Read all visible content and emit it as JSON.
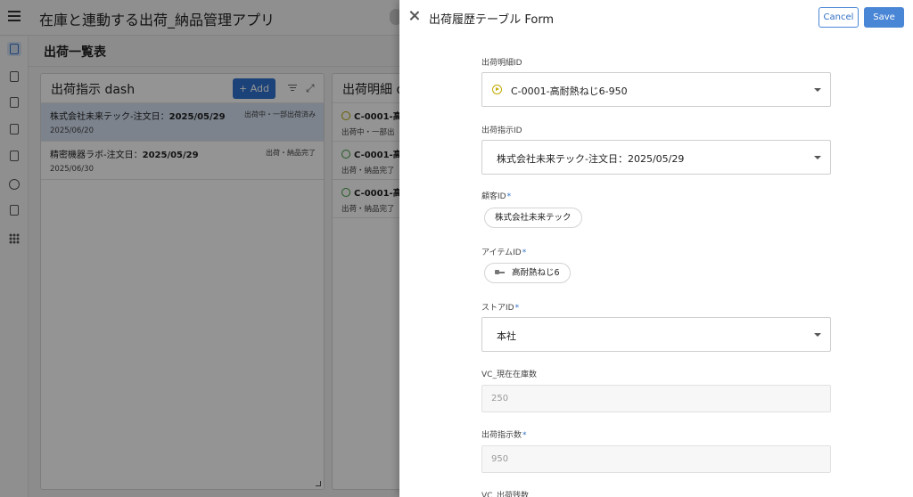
{
  "app": {
    "title": "在庫と連動する出荷_納品管理アプリ",
    "section_title": "出荷一覧表"
  },
  "left_panel": {
    "title": "出荷指示 dash",
    "add_label": "+ Add",
    "rows": [
      {
        "title_prefix": "株式会社未来テック-注文日：",
        "title_date": "2025/05/29",
        "status": "出荷中・一部出荷済み",
        "sub": "2025/06/20"
      },
      {
        "title_prefix": "精密機器ラボ-注文日：",
        "title_date": "2025/05/29",
        "status": "出荷・納品完了",
        "sub": "2025/06/30"
      }
    ]
  },
  "right_panel": {
    "title": "出荷明細 da",
    "rows": [
      {
        "title": "C-0001-高",
        "sub": "出荷中・一部出",
        "icon": "play-circle-icon"
      },
      {
        "title": "C-0001-高",
        "sub": "出荷・納品完了",
        "icon": "check-circle-icon"
      },
      {
        "title": "C-0001-高",
        "sub": "出荷・納品完了",
        "icon": "check-circle-icon"
      }
    ]
  },
  "form": {
    "title": "出荷履歴テーブル Form",
    "cancel_label": "Cancel",
    "save_label": "Save",
    "fields": {
      "detail_id": {
        "label": "出荷明細ID",
        "value": "C-0001-高耐熱ねじ6-950"
      },
      "order_id": {
        "label": "出荷指示ID",
        "value": "株式会社未来テック-注文日：2025/05/29"
      },
      "customer_id": {
        "label": "顧客ID",
        "required_mark": "*",
        "value": "株式会社未来テック"
      },
      "item_id": {
        "label": "アイテムID",
        "required_mark": "*",
        "value": "高耐熱ねじ6"
      },
      "store_id": {
        "label": "ストアID",
        "required_mark": "*",
        "value": "本社"
      },
      "current_stock": {
        "label": "VC_現在在庫数",
        "value": "250"
      },
      "order_qty": {
        "label": "出荷指示数",
        "required_mark": "*",
        "value": "950"
      },
      "remaining": {
        "label": "VC_出荷残数"
      }
    }
  },
  "colors": {
    "accent": "#4a86d6",
    "selected_row": "#d6e2f3",
    "overlay": "rgba(0,0,0,0.42)"
  }
}
